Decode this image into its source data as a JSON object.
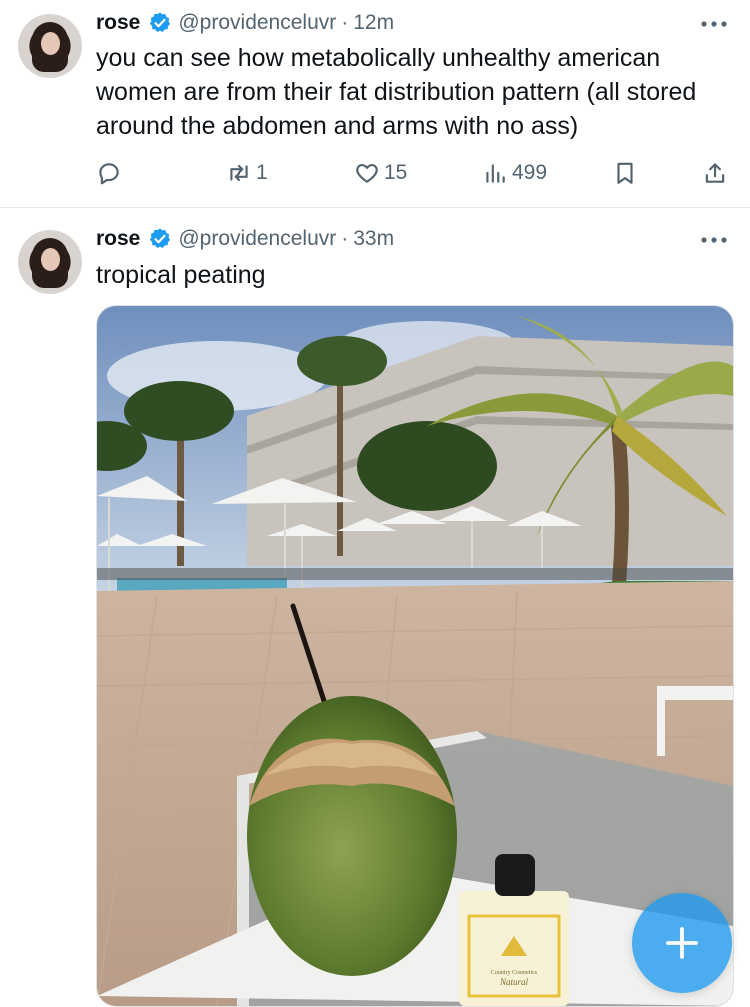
{
  "tweets": [
    {
      "name": "rose",
      "handle": "@providenceluvr",
      "separator": "·",
      "time": "12m",
      "text": "you can see how metabolically unhealthy american women are from their fat distribution pattern (all stored around the abdomen and arms with no ass)",
      "stats": {
        "reposts": "1",
        "likes": "15",
        "views": "499"
      }
    },
    {
      "name": "rose",
      "handle": "@providenceluvr",
      "separator": "·",
      "time": "33m",
      "text": "tropical peating",
      "media_label_1": "Country Cosmetics",
      "media_label_2": "Natural"
    }
  ],
  "colors": {
    "accent": "#1d9bf0",
    "text": "#0f1419",
    "muted": "#536471"
  },
  "icons": [
    "verified-badge-icon",
    "more-icon",
    "reply-icon",
    "repost-icon",
    "like-icon",
    "views-icon",
    "bookmark-icon",
    "share-icon",
    "compose-plus-icon"
  ]
}
